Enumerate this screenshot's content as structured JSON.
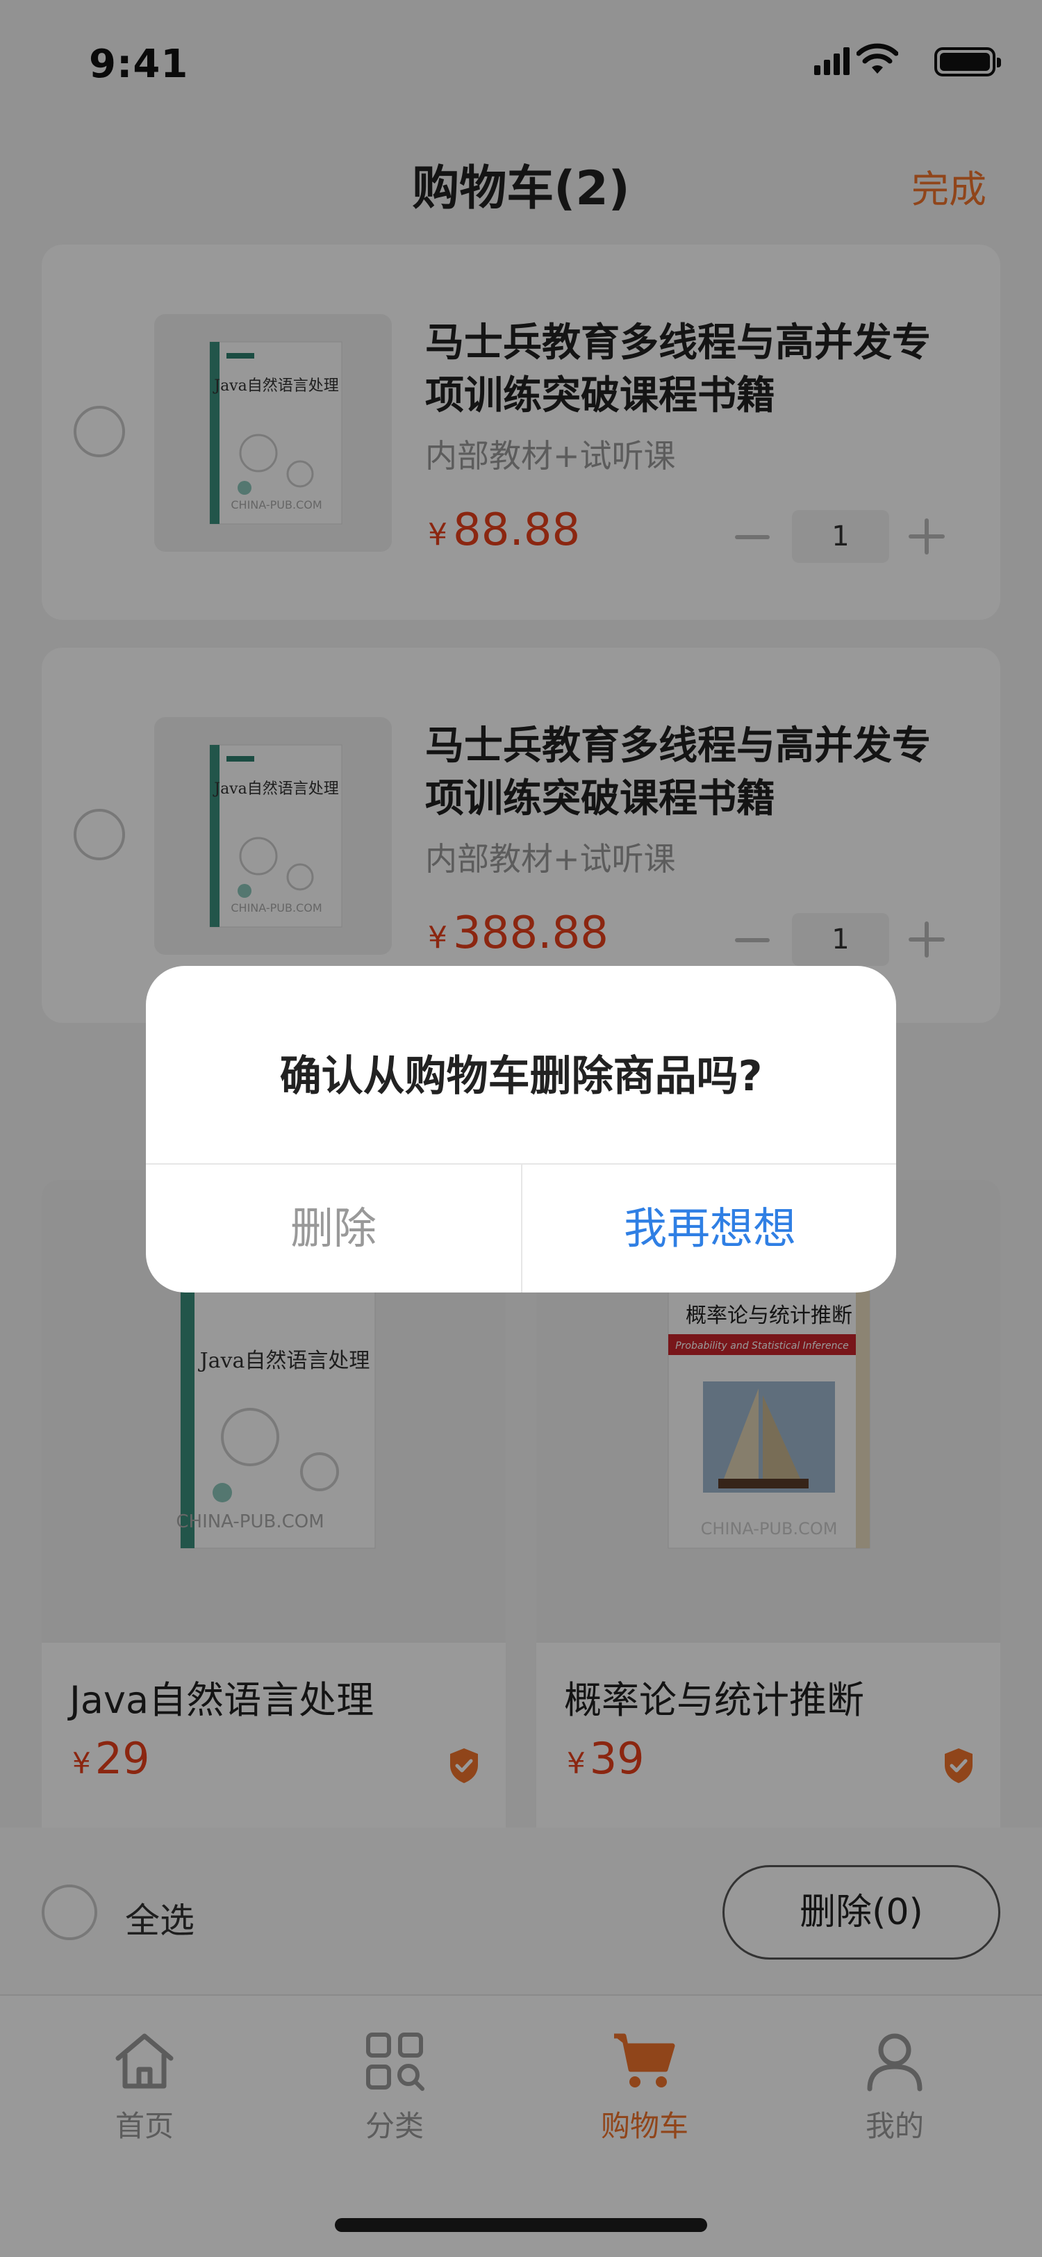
{
  "status": {
    "time": "9:41"
  },
  "header": {
    "title": "购物车(2)",
    "action": "完成"
  },
  "cart_items": [
    {
      "name_line1": "马士兵教育多线程与高并发专",
      "name_line2": "项训练突破课程书籍",
      "subtitle": "内部教材+试听课",
      "currency": "¥",
      "price": "88.88",
      "qty": "1"
    },
    {
      "name_line1": "马士兵教育多线程与高并发专",
      "name_line2": "项训练突破课程书籍",
      "subtitle": "内部教材+试听课",
      "currency": "¥",
      "price": "388.88",
      "qty": "1"
    }
  ],
  "book_cover": {
    "title": "Java自然语言处理",
    "watermark": "CHINA-PUB.COM"
  },
  "recommendations": [
    {
      "name": "Java自然语言处理",
      "currency": "¥",
      "price": "29",
      "cover_title": "Java自然语言处理",
      "watermark": "CHINA-PUB.COM"
    },
    {
      "name": "概率论与统计推断",
      "currency": "¥",
      "price": "39",
      "cover_title": "概率论与统计推断",
      "cover_subtitle": "Probability and Statistical Inference",
      "watermark": "CHINA-PUB.COM"
    }
  ],
  "action_bar": {
    "select_all": "全选",
    "delete_button": "删除(0)"
  },
  "tabs": [
    {
      "label": "首页",
      "icon": "home-icon"
    },
    {
      "label": "分类",
      "icon": "category-icon"
    },
    {
      "label": "购物车",
      "icon": "cart-icon"
    },
    {
      "label": "我的",
      "icon": "profile-icon"
    }
  ],
  "active_tab": "购物车",
  "dialog": {
    "message": "确认从购物车删除商品吗?",
    "cancel": "删除",
    "confirm": "我再想想"
  },
  "colors": {
    "accent": "#f0742c",
    "price": "#e8401c",
    "confirm": "#2f7fe4"
  }
}
